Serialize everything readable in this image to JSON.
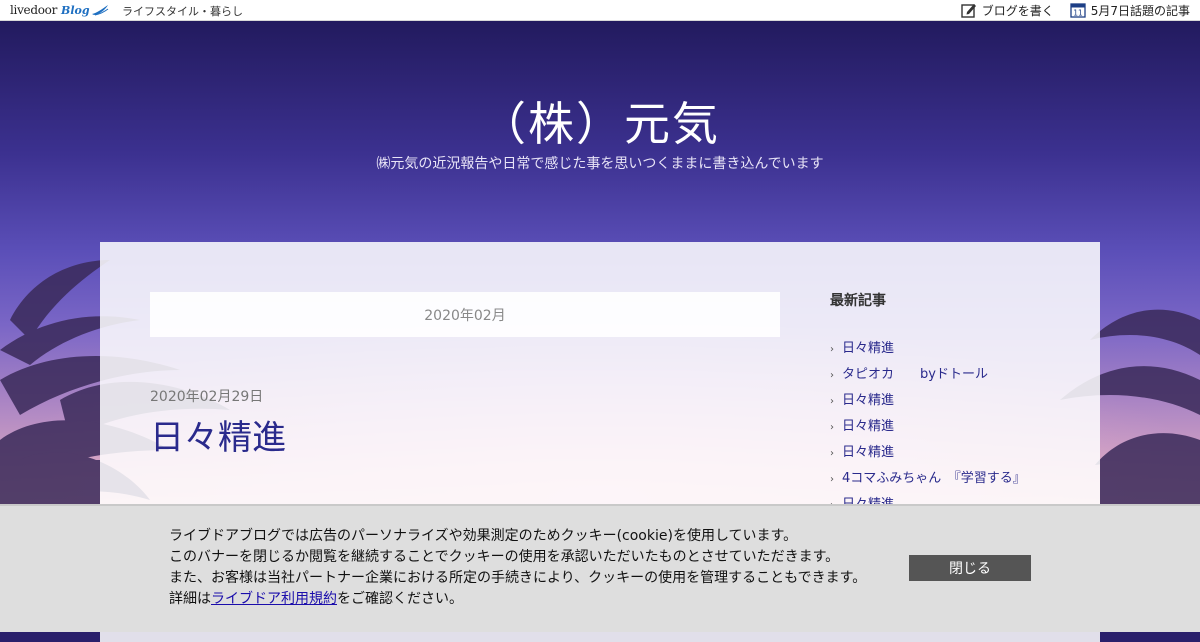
{
  "topbar": {
    "logo_text": "livedoor",
    "logo_sub": "Blog",
    "category": "ライフスタイル・暮らし",
    "write_label": "ブログを書く",
    "calendar_day": "11",
    "trending_label": "5月7日話題の記事"
  },
  "header": {
    "title": "（株）元気",
    "description": "㈱元気の近況報告や日常で感じた事を思いつくままに書き込んでいます"
  },
  "main": {
    "archive_label": "2020年02月",
    "post": {
      "date": "2020年02月29日",
      "title": "日々精進"
    }
  },
  "sidebar": {
    "heading": "最新記事",
    "items": [
      {
        "label": "日々精進"
      },
      {
        "label": "タピオカ　　byドトール"
      },
      {
        "label": "日々精進"
      },
      {
        "label": "日々精進"
      },
      {
        "label": "日々精進"
      },
      {
        "label": "4コマふみちゃん　『学習する』"
      },
      {
        "label": "日々精進"
      }
    ]
  },
  "cookie": {
    "line1": "ライブドアブログでは広告のパーソナライズや効果測定のためクッキー(cookie)を使用しています。",
    "line2": "このバナーを閉じるか閲覧を継続することでクッキーの使用を承認いただいたものとさせていただきます。",
    "line3": "また、お客様は当社パートナー企業における所定の手続きにより、クッキーの使用を管理することもできます。",
    "line4_prefix": "詳細は",
    "line4_link": "ライブドア利用規約",
    "line4_suffix": "をご確認ください。",
    "close_label": "閉じる"
  },
  "colors": {
    "accent_link": "#2a2a8c",
    "close_button": "#555555",
    "banner_bg": "#dedede"
  }
}
